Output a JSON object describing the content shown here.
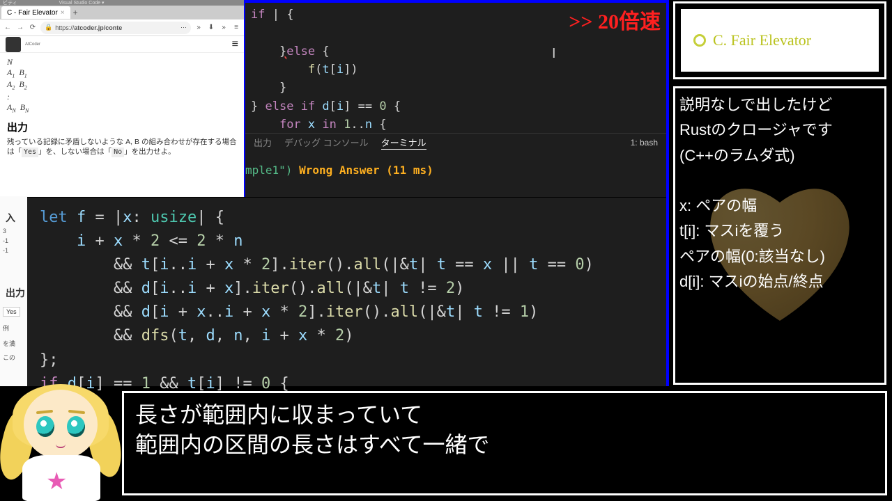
{
  "browser": {
    "titlebar_left": "ビティ",
    "titlebar_vscode": "Visual Studio Code ▾",
    "tab_title": "C - Fair Elevator",
    "url_prefix": "https://",
    "url_host": "atcoder.jp/conte",
    "logo_text": "AtCoder"
  },
  "problem": {
    "vars": "N\nA₁  B₁\nA₂  B₂\n:\nA_N  B_N",
    "out_heading": "出力",
    "out_text_1": "残っている記録に矛盾しないような A, B の組み合わせが存在する場合は「",
    "yes": "Yes",
    "out_text_2": "」を、しない場合は「",
    "no": "No",
    "out_text_3": "」を出力せよ。",
    "in_heading": "入",
    "out_heading2": "出力",
    "yes_btn": "Yes",
    "ex_label": "例",
    "wo_label": "を満",
    "kono": "この"
  },
  "editor": {
    "code_top": "    if | {\n\n    }else {\n        f(t[i])\n    }\n} else if d[i] == 0 {\n    for x in 1..n {",
    "speed_label": ">> 20倍速",
    "terminal_tabs": {
      "output": "出力",
      "debug": "デバッグ コンソール",
      "terminal": "ターミナル",
      "selector": "1: bash"
    },
    "terminal_line_sample": "mple1\")",
    "terminal_line_wa": " Wrong Answer (11 ms)"
  },
  "overlay_code": {
    "l1": "let f = |x: usize| {",
    "l2": "    i + x * 2 <= 2 * n",
    "l3": "        && t[i..i + x * 2].iter().all(|&t| t == x || t == 0)",
    "l4": "        && d[i..i + x].iter().all(|&t| t != 2)",
    "l5": "        && d[i + x..i + x * 2].iter().all(|&t| t != 1)",
    "l6": "        && dfs(t, d, n, i + x * 2)",
    "l7": "};",
    "l8": "if d[i] == 1 && t[i] != 0 {"
  },
  "right_title": "C. Fair Elevator",
  "right_notes": "説明なしで出したけど\nRustのクロージャです\n(C++のラムダ式)\n\nx: ペアの幅\nt[i]: マスiを覆う\nペアの幅(0:該当なし)\nd[i]: マスiの始点/終点",
  "subtitle": "長さが範囲内に収まっていて\n範囲内の区間の長さはすべて一緒で",
  "gutter": {
    "n3": "3",
    "nm1a": "-1",
    "nm1b": "-1"
  }
}
